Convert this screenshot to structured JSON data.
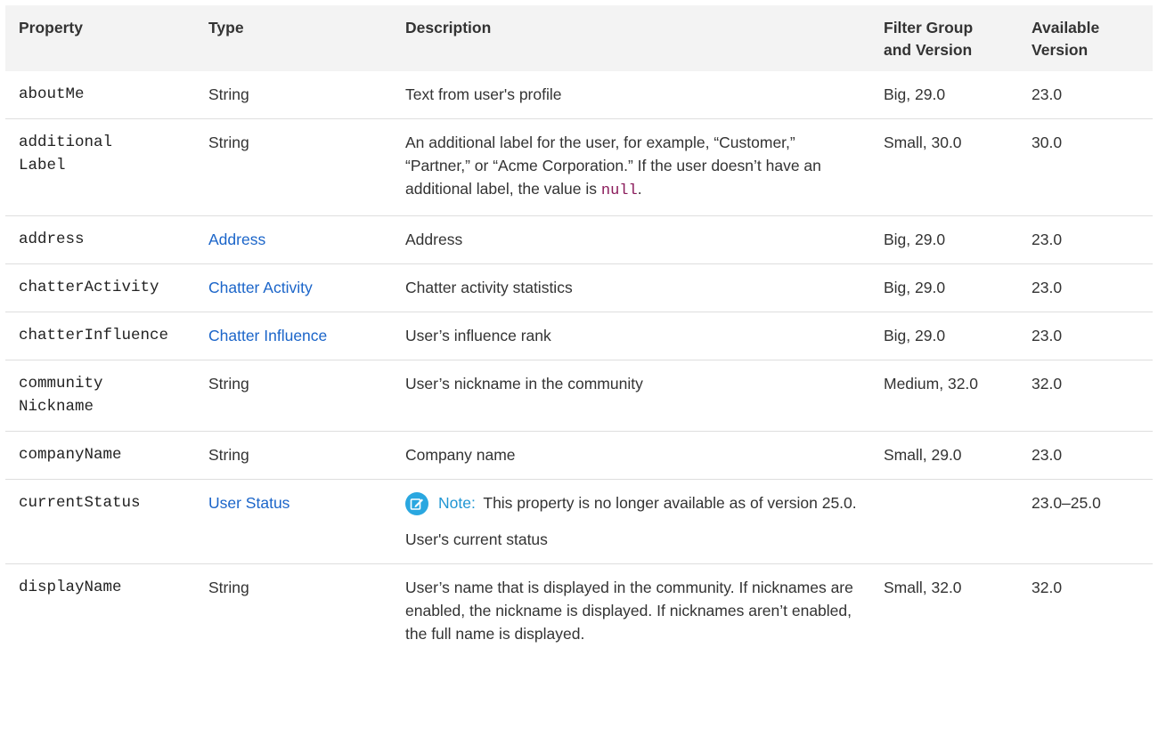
{
  "headers": {
    "property": "Property",
    "type": "Type",
    "description": "Description",
    "filter_group_line1": "Filter Group",
    "filter_group_line2": "and Version",
    "available_line1": "Available",
    "available_line2": "Version"
  },
  "rows": [
    {
      "property_lines": [
        "aboutMe"
      ],
      "type": "String",
      "description": "Text from user's profile",
      "filter": "Big, 29.0",
      "available": "23.0"
    },
    {
      "property_lines": [
        "additional",
        "Label"
      ],
      "type": "String",
      "description_prefix": "An additional label for the user, for example, “Customer,” “Partner,” or “Acme Corporation.” If the user doesn’t have an additional label, the value is ",
      "description_code": "null",
      "description_suffix": ".",
      "filter": "Small, 30.0",
      "available": "30.0"
    },
    {
      "property_lines": [
        "address"
      ],
      "type": "Address",
      "description": "Address",
      "filter": "Big, 29.0",
      "available": "23.0"
    },
    {
      "property_lines": [
        "chatterActivity"
      ],
      "type": "Chatter Activity",
      "description": "Chatter activity statistics",
      "filter": "Big, 29.0",
      "available": "23.0"
    },
    {
      "property_lines": [
        "chatterInfluence"
      ],
      "type": "Chatter Influence",
      "description": "User’s influence rank",
      "filter": "Big, 29.0",
      "available": "23.0"
    },
    {
      "property_lines": [
        "community",
        "Nickname"
      ],
      "type": "String",
      "description": "User’s nickname in the community",
      "filter": "Medium, 32.0",
      "available": "32.0"
    },
    {
      "property_lines": [
        "companyName"
      ],
      "type": "String",
      "description": "Company name",
      "filter": "Small, 29.0",
      "available": "23.0"
    },
    {
      "property_lines": [
        "currentStatus"
      ],
      "type": "User Status",
      "note_label": "Note:",
      "note_text": "This property is no longer available as of version 25.0.",
      "description": "User's current status",
      "filter": "",
      "available": "23.0–25.0"
    },
    {
      "property_lines": [
        "displayName"
      ],
      "type": "String",
      "description": "User’s name that is displayed in the community. If nicknames are enabled, the nickname is displayed. If nicknames aren’t enabled, the full name is displayed.",
      "filter": "Small, 32.0",
      "available": "32.0"
    }
  ],
  "icons": {
    "note": "edit-note-icon"
  },
  "colors": {
    "link": "#1b65c9",
    "note_label": "#2196d3",
    "note_icon": "#2aa7e0",
    "code": "#8a1a5a",
    "header_bg": "#f3f3f3"
  }
}
